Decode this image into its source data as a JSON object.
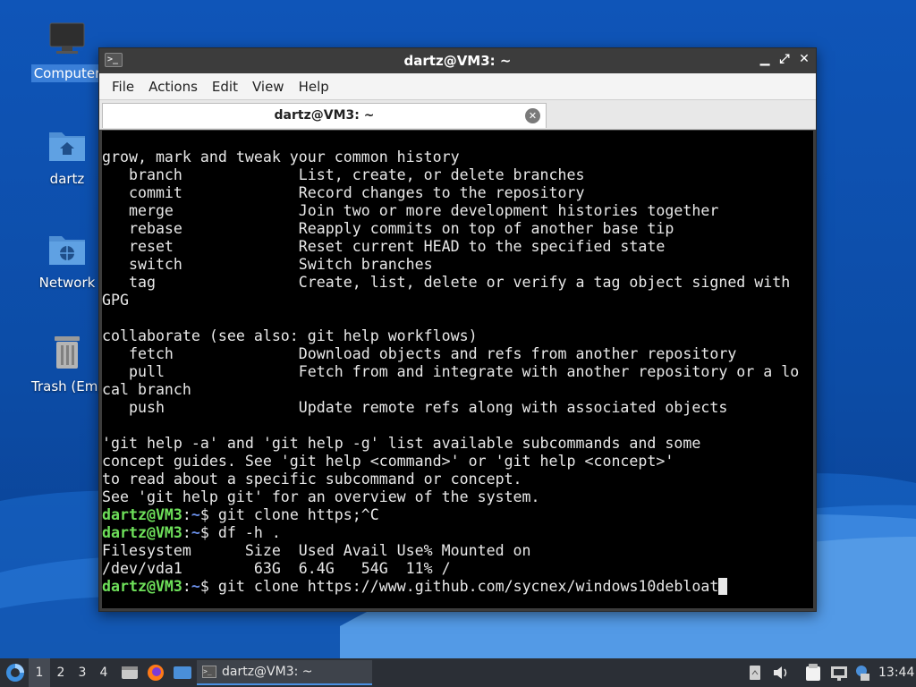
{
  "desktop": {
    "icons": [
      {
        "label": "Computer",
        "icon": "computer-icon"
      },
      {
        "label": "dartz",
        "icon": "home-folder-icon"
      },
      {
        "label": "Network",
        "icon": "network-folder-icon"
      },
      {
        "label": "Trash (Empt",
        "icon": "trash-icon"
      }
    ]
  },
  "window": {
    "title": "dartz@VM3: ~",
    "controls": {
      "minimize": "▁",
      "maximize": "⤢",
      "close": "✕"
    },
    "menu": [
      "File",
      "Actions",
      "Edit",
      "View",
      "Help"
    ],
    "tab": {
      "label": "dartz@VM3: ~",
      "close": "✕"
    }
  },
  "terminal": {
    "lines": [
      {
        "text": "grow, mark and tweak your common history"
      },
      {
        "text": "   branch             List, create, or delete branches"
      },
      {
        "text": "   commit             Record changes to the repository"
      },
      {
        "text": "   merge              Join two or more development histories together"
      },
      {
        "text": "   rebase             Reapply commits on top of another base tip"
      },
      {
        "text": "   reset              Reset current HEAD to the specified state"
      },
      {
        "text": "   switch             Switch branches"
      },
      {
        "text": "   tag                Create, list, delete or verify a tag object signed with"
      },
      {
        "text": "GPG"
      },
      {
        "text": ""
      },
      {
        "text": "collaborate (see also: git help workflows)"
      },
      {
        "text": "   fetch              Download objects and refs from another repository"
      },
      {
        "text": "   pull               Fetch from and integrate with another repository or a lo"
      },
      {
        "text": "cal branch"
      },
      {
        "text": "   push               Update remote refs along with associated objects"
      },
      {
        "text": ""
      },
      {
        "text": "'git help -a' and 'git help -g' list available subcommands and some"
      },
      {
        "text": "concept guides. See 'git help <command>' or 'git help <concept>'"
      },
      {
        "text": "to read about a specific subcommand or concept."
      },
      {
        "text": "See 'git help git' for an overview of the system."
      },
      {
        "user": "dartz@VM3",
        "path": "~",
        "text": "$ git clone https;^C"
      },
      {
        "user": "dartz@VM3",
        "path": "~",
        "text": "$ df -h ."
      },
      {
        "text": "Filesystem      Size  Used Avail Use% Mounted on"
      },
      {
        "text": "/dev/vda1        63G  6.4G   54G  11% /"
      },
      {
        "user": "dartz@VM3",
        "path": "~",
        "text": "$ git clone https://www.github.com/sycnex/windows10debloat",
        "cursor": true
      }
    ]
  },
  "taskbar": {
    "workspaces": [
      "1",
      "2",
      "3",
      "4"
    ],
    "active_workspace": "1",
    "task_label": "dartz@VM3: ~",
    "clock": "13:44"
  },
  "colors": {
    "prompt_user": "#6ee05a",
    "prompt_path": "#6a8fe8",
    "desktop_blue": "#0f55b8",
    "taskbar": "#2b2f36"
  }
}
